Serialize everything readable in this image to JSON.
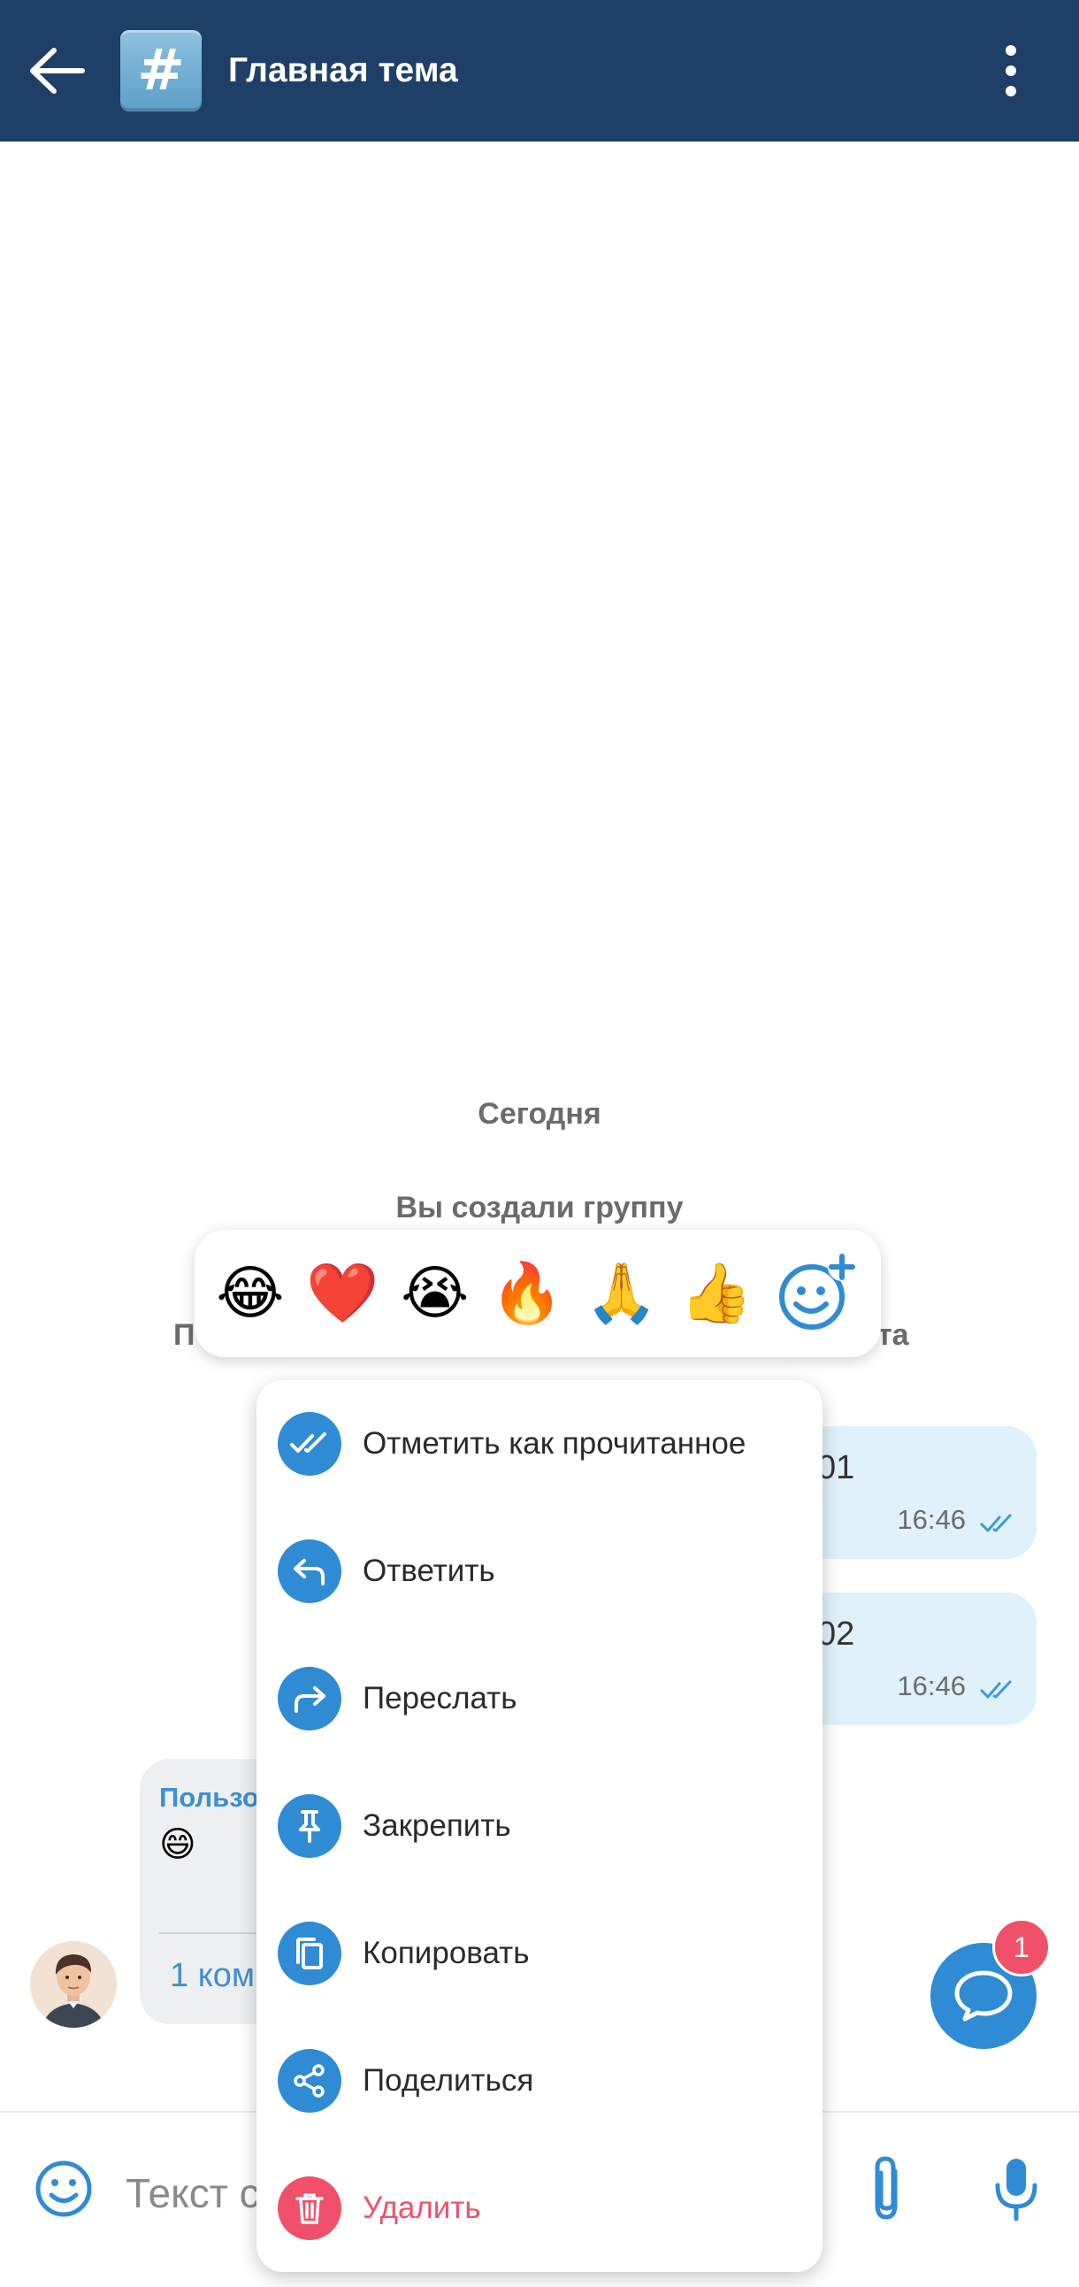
{
  "header": {
    "title": "Главная тема",
    "badge_symbol": "#",
    "bg_color": "#1e3f66"
  },
  "chat": {
    "date_separator": "Сегодня",
    "system_message": "Вы создали группу",
    "system_message_2_start": "П",
    "system_message_2_end": "та",
    "outgoing": [
      {
        "text": "01",
        "time": "16:46",
        "status": "read"
      },
      {
        "text": "02",
        "time": "16:46",
        "status": "read"
      }
    ],
    "incoming": {
      "sender": "Пользо",
      "text": "😄",
      "comments": "1 ком"
    }
  },
  "reactions": [
    "😂",
    "❤️",
    "😭",
    "🔥",
    "🙏",
    "👍"
  ],
  "context_menu": {
    "items": [
      {
        "label": "Отметить как прочитанное",
        "icon": "double-check-icon"
      },
      {
        "label": "Ответить",
        "icon": "reply-icon"
      },
      {
        "label": "Переслать",
        "icon": "forward-icon"
      },
      {
        "label": "Закрепить",
        "icon": "pin-icon"
      },
      {
        "label": "Копировать",
        "icon": "copy-icon"
      },
      {
        "label": "Поделиться",
        "icon": "share-icon"
      },
      {
        "label": "Удалить",
        "icon": "trash-icon",
        "danger": true
      }
    ]
  },
  "composer": {
    "placeholder": "Текст сообщения"
  },
  "fab": {
    "badge_count": "1"
  },
  "colors": {
    "accent": "#2f8bd3",
    "danger": "#f0506a",
    "outgoing_bubble": "#dff1fb",
    "incoming_bubble": "#eeeff1"
  }
}
